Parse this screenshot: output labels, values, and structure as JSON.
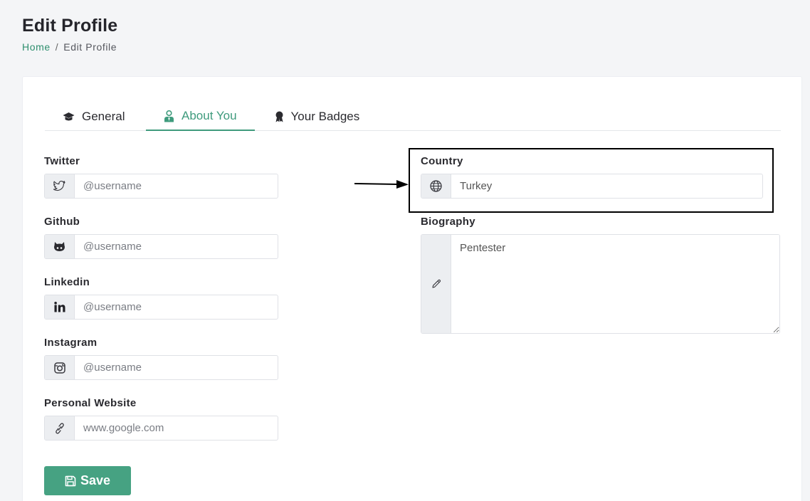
{
  "header": {
    "title": "Edit Profile",
    "breadcrumb": {
      "home": "Home",
      "separator": "/",
      "current": "Edit Profile"
    }
  },
  "tabs": [
    {
      "label": "General",
      "icon": "graduation-cap-icon",
      "active": false
    },
    {
      "label": "About You",
      "icon": "user-tie-icon",
      "active": true
    },
    {
      "label": "Your Badges",
      "icon": "award-ribbon-icon",
      "active": false
    }
  ],
  "fields": {
    "twitter": {
      "label": "Twitter",
      "placeholder": "@username",
      "value": "",
      "icon": "twitter-icon"
    },
    "github": {
      "label": "Github",
      "placeholder": "@username",
      "value": "",
      "icon": "github-icon"
    },
    "linkedin": {
      "label": "Linkedin",
      "placeholder": "@username",
      "value": "",
      "icon": "linkedin-icon"
    },
    "instagram": {
      "label": "Instagram",
      "placeholder": "@username",
      "value": "",
      "icon": "instagram-icon"
    },
    "website": {
      "label": "Personal Website",
      "placeholder": "www.google.com",
      "value": "",
      "icon": "link-icon"
    },
    "country": {
      "label": "Country",
      "placeholder": "",
      "value": "Turkey",
      "icon": "globe-icon"
    },
    "biography": {
      "label": "Biography",
      "value": "Pentester",
      "icon": "pencil-icon"
    }
  },
  "actions": {
    "save_label": "Save"
  },
  "colors": {
    "accent": "#46a282",
    "accent_text": "#3f9b7d",
    "link": "#2e8f6e"
  }
}
